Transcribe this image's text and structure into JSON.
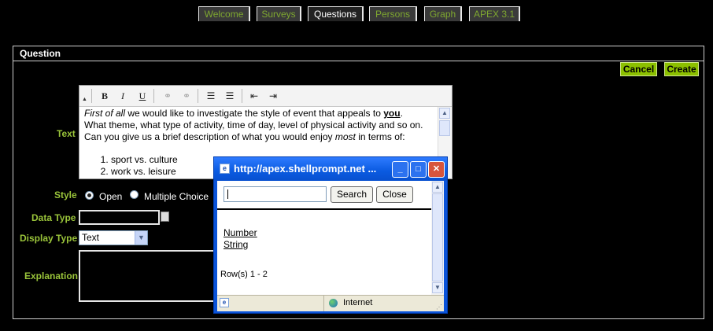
{
  "tabs": [
    {
      "label": "Welcome",
      "active": false
    },
    {
      "label": "Surveys",
      "active": false
    },
    {
      "label": "Questions",
      "active": true
    },
    {
      "label": "Persons",
      "active": false
    },
    {
      "label": "Graph",
      "active": false
    },
    {
      "label": "APEX 3.1",
      "active": false
    }
  ],
  "region": {
    "title": "Question",
    "cancel_label": "Cancel",
    "create_label": "Create"
  },
  "labels": {
    "text": "Text",
    "style": "Style",
    "data_type": "Data Type",
    "display_type": "Display Type",
    "explanation": "Explanation"
  },
  "editor": {
    "toolbar": {
      "bold": "B",
      "italic": "I",
      "underline": "U"
    },
    "p1_lead": "First of all",
    "p1_a": " we would like to investigate the style of event that appeals to ",
    "p1_you": "you",
    "p1_b": ". What theme, what type of activity, time of day, level of physical activity and so on. Can you give us a brief description of what you would enjoy ",
    "p1_most": "most",
    "p1_c": " in terms of:",
    "list": [
      "sport vs. culture",
      "work vs. leisure"
    ]
  },
  "style": {
    "options": [
      {
        "label": "Open",
        "selected": true
      },
      {
        "label": "Multiple Choice",
        "selected": false
      }
    ]
  },
  "data_type": {
    "value": ""
  },
  "display_type": {
    "value": "Text"
  },
  "explanation": {
    "value": ""
  },
  "popup": {
    "title": "http://apex.shellprompt.net ...",
    "search_value": "",
    "search_label": "Search",
    "close_label": "Close",
    "items": [
      "Number",
      "String"
    ],
    "rows_text": "Row(s) 1 - 2",
    "status_zone": "Internet"
  },
  "colors": {
    "accent": "#8cc000",
    "label": "#9ac43a",
    "background": "#000000",
    "xp_title": "#0a53d9"
  }
}
